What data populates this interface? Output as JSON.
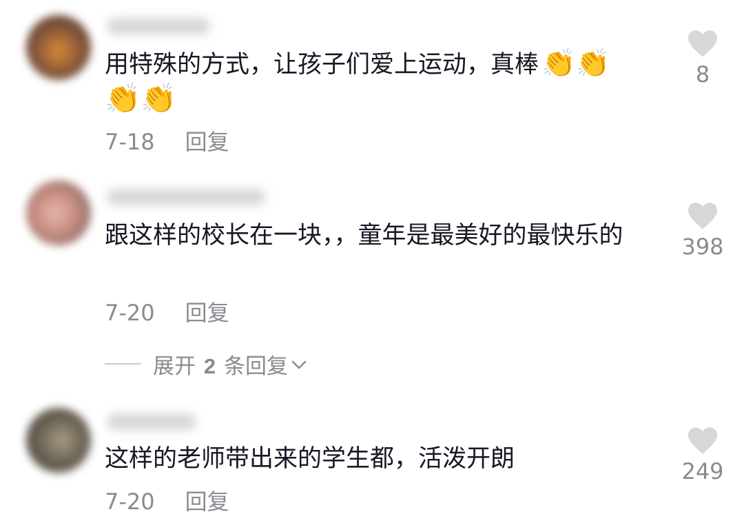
{
  "comments": [
    {
      "text": "用特殊的方式，让孩子们爱上运动，真棒",
      "emoji": "👏👏",
      "emoji_line": "👏👏",
      "date": "7-18",
      "reply_label": "回复",
      "likes": "8",
      "avatar_colors": [
        "#7a4a33",
        "#c97a2e"
      ]
    },
    {
      "text": "跟这样的校长在一块，，童年是最美好的最快乐的",
      "date": "7-20",
      "reply_label": "回复",
      "likes": "398",
      "avatar_colors": [
        "#d8a9a0",
        "#6f5a55"
      ]
    },
    {
      "text": "这样的老师带出来的学生都，活泼开朗",
      "date": "7-20",
      "reply_label": "回复",
      "likes": "249",
      "avatar_colors": [
        "#5e574a",
        "#a49a82"
      ]
    }
  ],
  "expand_replies": {
    "prefix": "展开",
    "count": "2",
    "suffix": "条回复"
  },
  "icons": {
    "like": "heart-icon",
    "expand": "chevron-down-icon"
  },
  "colors": {
    "text": "#161823",
    "secondary": "#8a8b91",
    "heart": "#d7d7d9"
  }
}
